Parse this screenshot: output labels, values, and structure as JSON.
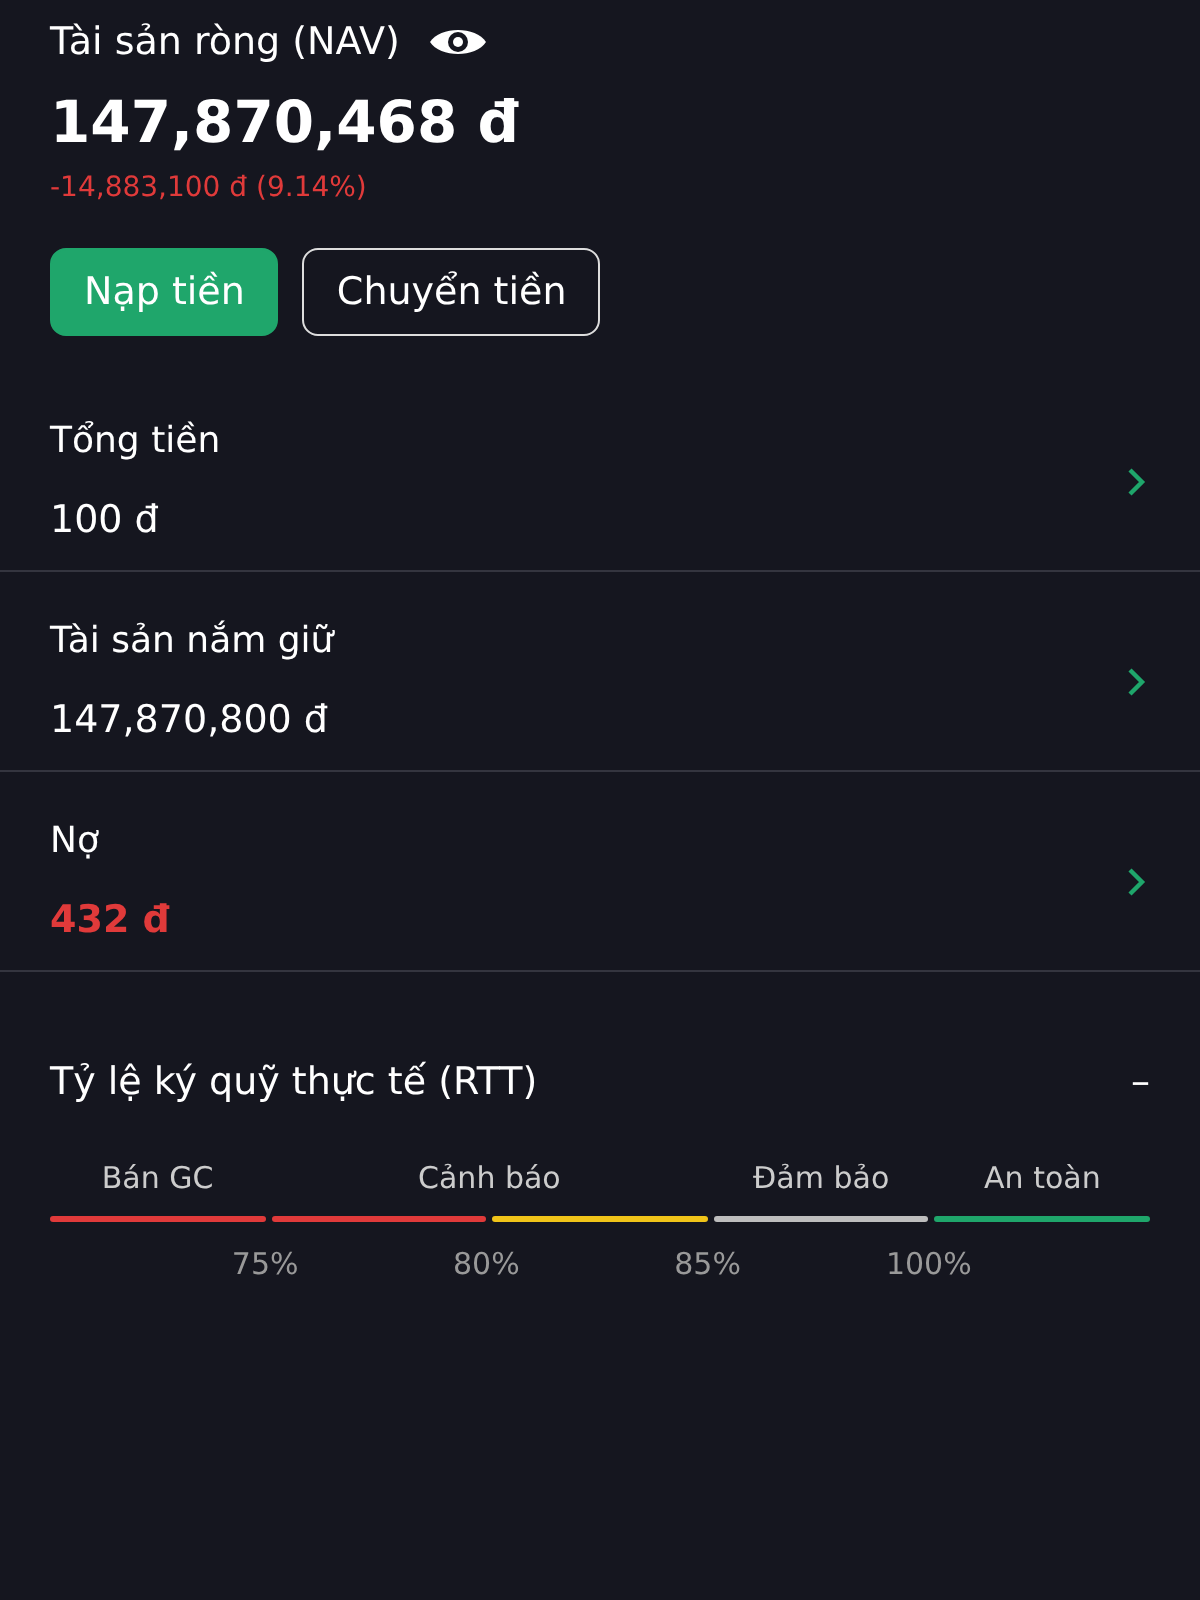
{
  "nav": {
    "title": "Tài sản ròng (NAV)",
    "value": "147,870,468 đ",
    "change": "-14,883,100 đ (9.14%)"
  },
  "buttons": [
    {
      "label": "Nạp tiền",
      "kind": "primary"
    },
    {
      "label": "Chuyển tiền",
      "kind": "outline"
    }
  ],
  "rows": [
    {
      "label": "Tổng tiền",
      "value": "100 đ",
      "kind": "normal"
    },
    {
      "label": "Tài sản nắm giữ",
      "value": "147,870,800 đ",
      "kind": "normal"
    },
    {
      "label": "Nợ",
      "value": "432 đ",
      "kind": "negative"
    }
  ],
  "rtt": {
    "title": "Tỷ lệ ký quỹ thực tế (RTT)",
    "value": "–",
    "zones": [
      "Bán GC",
      "Cảnh báo",
      "Đảm bảo",
      "An toàn"
    ],
    "segments": [
      {
        "color": "#e03a3a"
      },
      {
        "color": "#e03a3a"
      },
      {
        "color": "#f0c419"
      },
      {
        "color": "#bdbdbd"
      },
      {
        "color": "#1fa66b"
      }
    ],
    "ticks": [
      "75%",
      "80%",
      "85%",
      "100%"
    ]
  }
}
